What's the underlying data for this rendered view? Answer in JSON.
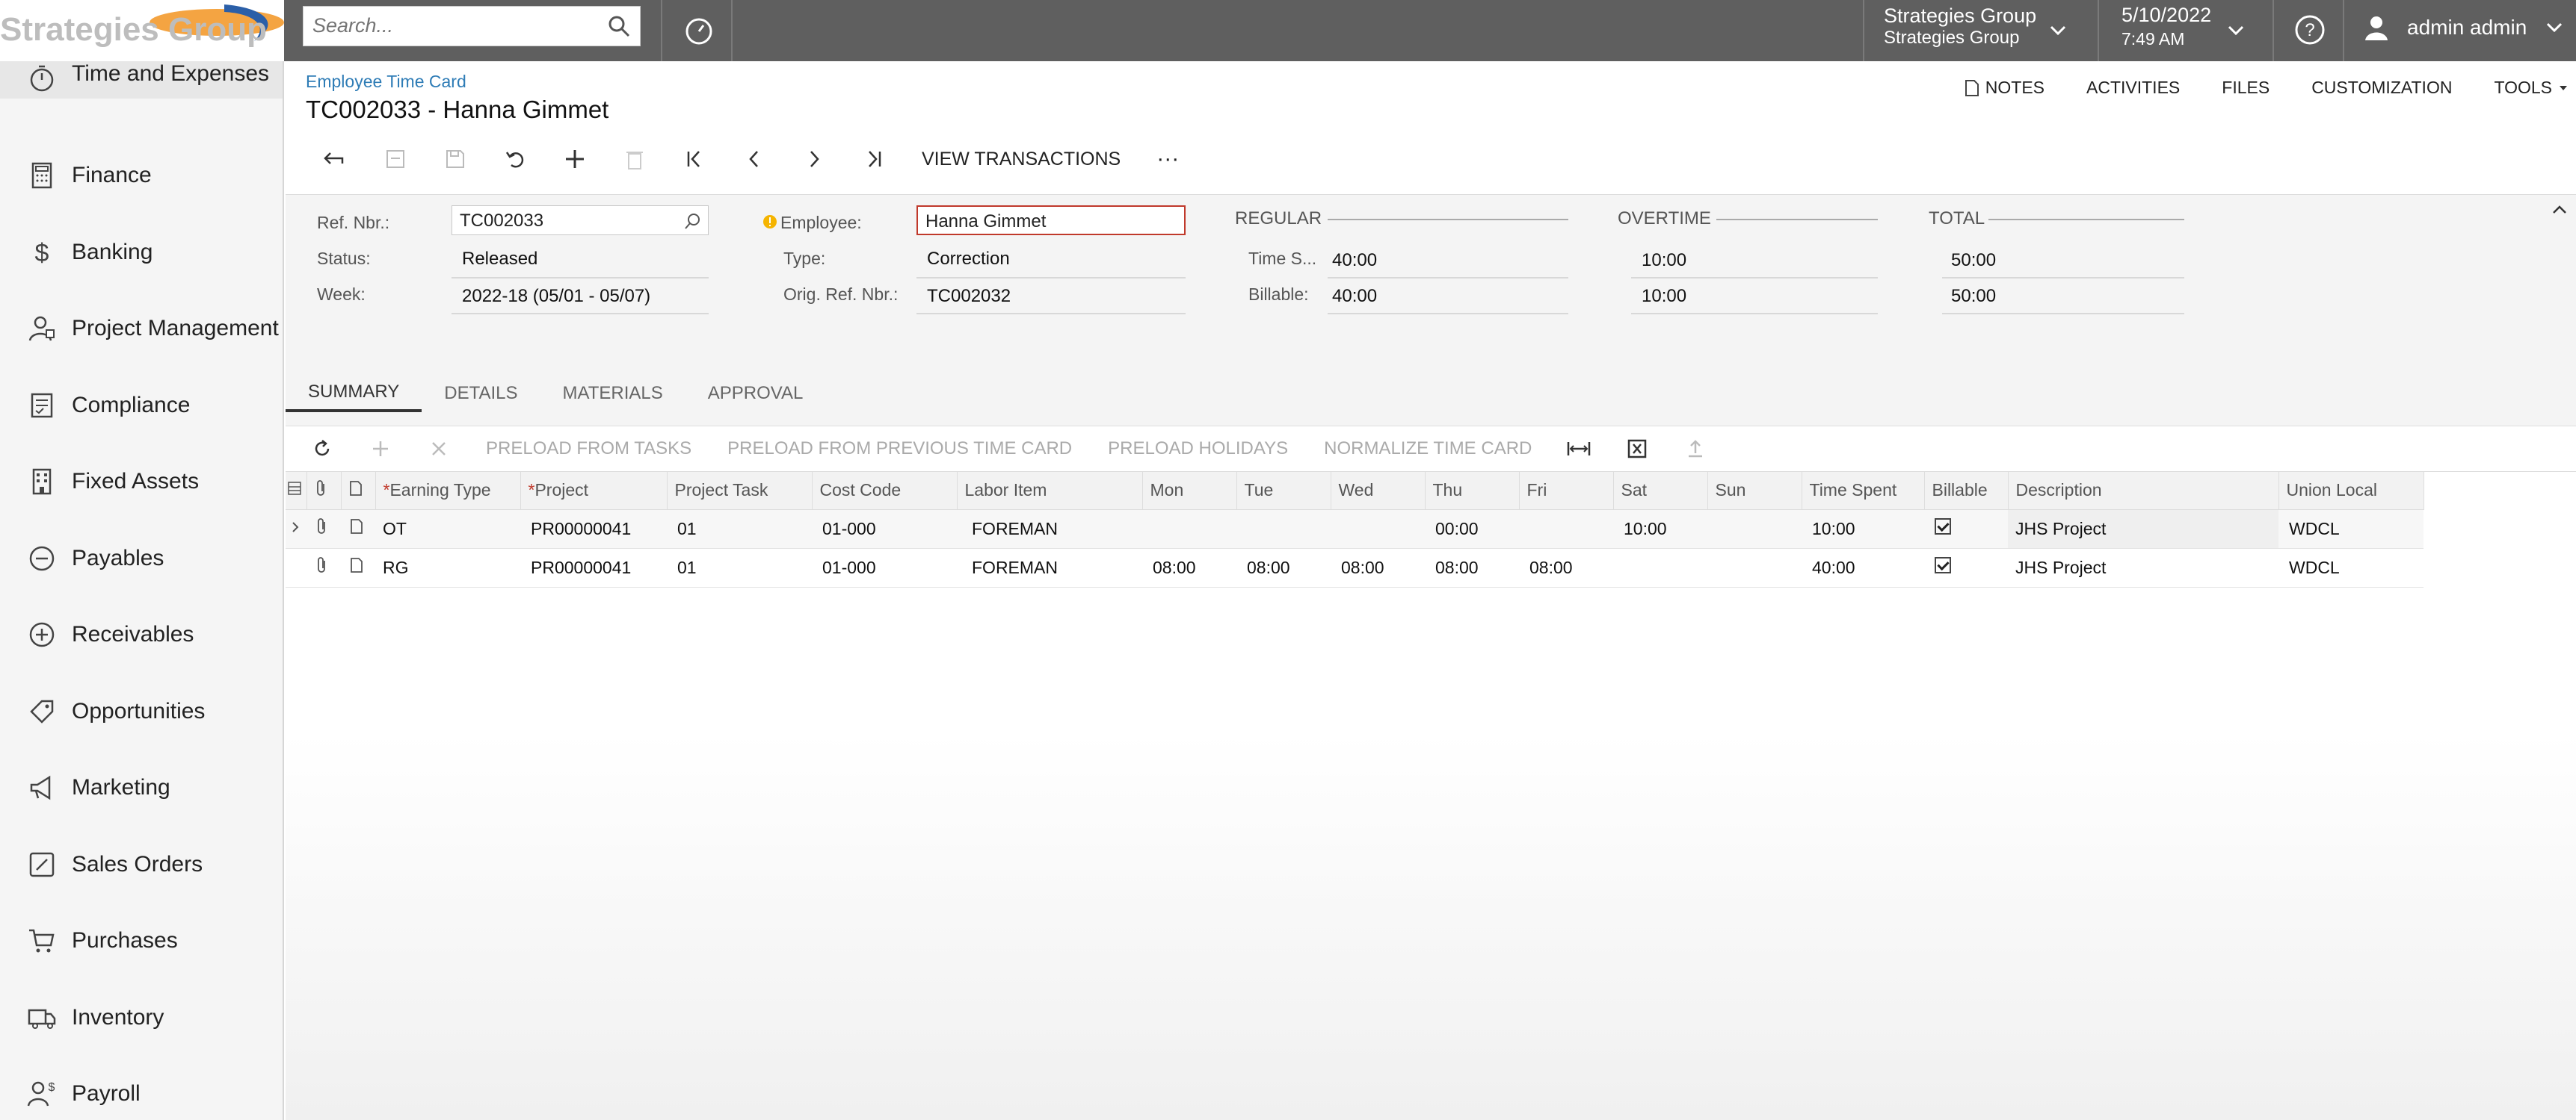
{
  "header": {
    "logo_text": "Strategies Group",
    "search_placeholder": "Search...",
    "tenant": {
      "name": "Strategies Group",
      "branch": "Strategies Group"
    },
    "date": "5/10/2022",
    "time": "7:49 AM",
    "user": "admin admin"
  },
  "sidebar": {
    "items": [
      {
        "label": "Time and Expenses",
        "icon": "stopwatch-icon"
      },
      {
        "label": "Finance",
        "icon": "calculator-icon"
      },
      {
        "label": "Banking",
        "icon": "dollar-icon"
      },
      {
        "label": "Project Management",
        "icon": "project-person-icon"
      },
      {
        "label": "Compliance",
        "icon": "checklist-icon"
      },
      {
        "label": "Fixed Assets",
        "icon": "building-icon"
      },
      {
        "label": "Payables",
        "icon": "minus-circle-icon"
      },
      {
        "label": "Receivables",
        "icon": "plus-circle-icon"
      },
      {
        "label": "Opportunities",
        "icon": "tag-icon"
      },
      {
        "label": "Marketing",
        "icon": "megaphone-icon"
      },
      {
        "label": "Sales Orders",
        "icon": "pencil-square-icon"
      },
      {
        "label": "Purchases",
        "icon": "cart-icon"
      },
      {
        "label": "Inventory",
        "icon": "truck-icon"
      },
      {
        "label": "Payroll",
        "icon": "person-dollar-icon"
      }
    ]
  },
  "page": {
    "breadcrumb": "Employee Time Card",
    "title": "TC002033 - Hanna Gimmet",
    "top_links": {
      "notes": "NOTES",
      "activities": "ACTIVITIES",
      "files": "FILES",
      "customization": "CUSTOMIZATION",
      "tools": "TOOLS"
    },
    "toolbar": {
      "view_transactions": "VIEW TRANSACTIONS",
      "more": "···"
    }
  },
  "form": {
    "ref_nbr_label": "Ref. Nbr.:",
    "ref_nbr": "TC002033",
    "status_label": "Status:",
    "status": "Released",
    "week_label": "Week:",
    "week": "2022-18 (05/01 - 05/07)",
    "employee_label": "Employee:",
    "employee": "Hanna Gimmet",
    "type_label": "Type:",
    "type": "Correction",
    "orig_ref_label": "Orig. Ref. Nbr.:",
    "orig_ref": "TC002032",
    "regular_title": "REGULAR",
    "overtime_title": "OVERTIME",
    "total_title": "TOTAL",
    "time_spent_label": "Time S...",
    "billable_label": "Billable:",
    "regular_time": "40:00",
    "regular_billable": "40:00",
    "overtime_time": "10:00",
    "overtime_billable": "10:00",
    "total_time": "50:00",
    "total_billable": "50:00"
  },
  "tabs": [
    "SUMMARY",
    "DETAILS",
    "MATERIALS",
    "APPROVAL"
  ],
  "grid_toolbar": {
    "preload_tasks": "PRELOAD FROM TASKS",
    "preload_prev": "PRELOAD FROM PREVIOUS TIME CARD",
    "preload_holidays": "PRELOAD HOLIDAYS",
    "normalize": "NORMALIZE TIME CARD"
  },
  "grid": {
    "columns": [
      "Earning Type",
      "Project",
      "Project Task",
      "Cost Code",
      "Labor Item",
      "Mon",
      "Tue",
      "Wed",
      "Thu",
      "Fri",
      "Sat",
      "Sun",
      "Time Spent",
      "Billable",
      "Description",
      "Union Local"
    ],
    "rows": [
      {
        "earning_type": "OT",
        "project": "PR00000041",
        "task": "01",
        "cost_code": "01-000",
        "labor_item": "FOREMAN",
        "mon": "",
        "tue": "",
        "wed": "",
        "thu": "00:00",
        "fri": "",
        "sat": "10:00",
        "sun": "",
        "time_spent": "10:00",
        "billable": true,
        "description": "JHS Project",
        "union": "WDCL"
      },
      {
        "earning_type": "RG",
        "project": "PR00000041",
        "task": "01",
        "cost_code": "01-000",
        "labor_item": "FOREMAN",
        "mon": "08:00",
        "tue": "08:00",
        "wed": "08:00",
        "thu": "08:00",
        "fri": "08:00",
        "sat": "",
        "sun": "",
        "time_spent": "40:00",
        "billable": true,
        "description": "JHS Project",
        "union": "WDCL"
      }
    ]
  }
}
